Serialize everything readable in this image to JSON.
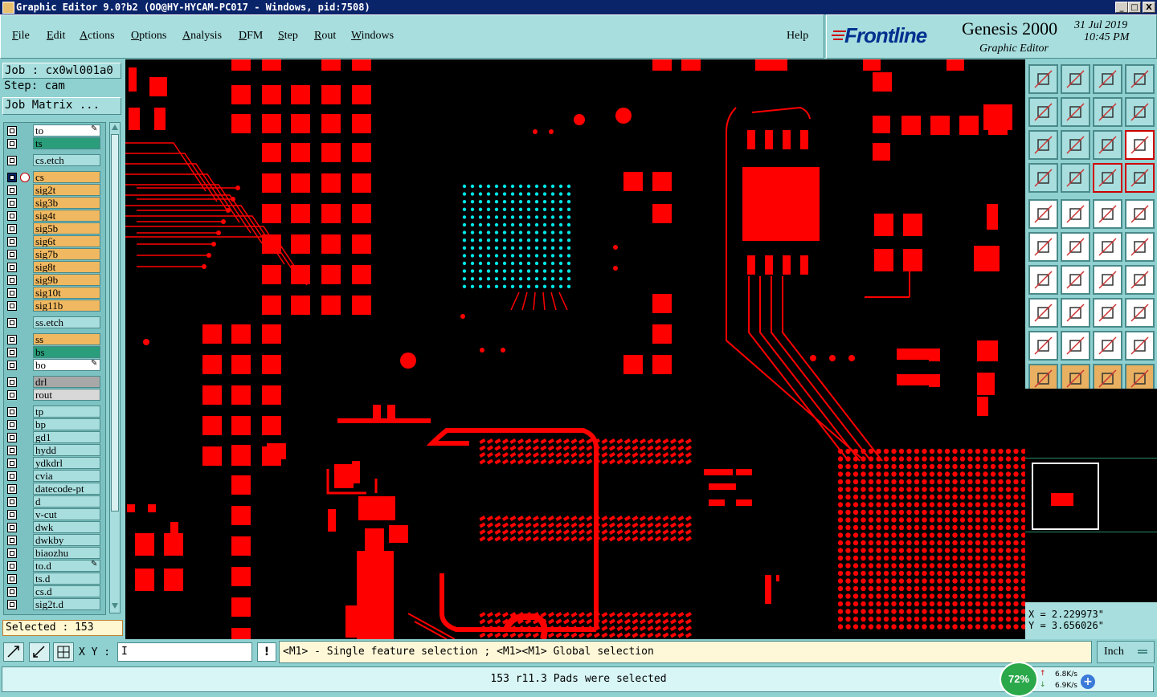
{
  "window": {
    "title": "Graphic Editor 9.0?b2  (OO@HY-HYCAM-PC017 - Windows, pid:7508)",
    "minimize_label": "_",
    "maximize_label": "□",
    "close_label": "X"
  },
  "menu": {
    "items": [
      {
        "underline": "F",
        "rest": "ile"
      },
      {
        "underline": "E",
        "rest": "dit"
      },
      {
        "underline": "A",
        "rest": "ctions"
      },
      {
        "underline": "O",
        "rest": "ptions"
      },
      {
        "underline": "A",
        "rest": "nalysis"
      },
      {
        "underline": "D",
        "rest": "FM"
      },
      {
        "underline": "S",
        "rest": "tep"
      },
      {
        "underline": "R",
        "rest": "out"
      },
      {
        "underline": "W",
        "rest": "indows"
      }
    ],
    "help": "Help"
  },
  "brand": {
    "logo": "Frontline",
    "product": "Genesis 2000",
    "subtitle": "Graphic Editor",
    "date": "31 Jul 2019",
    "time": "10:45 PM"
  },
  "job": {
    "job_label": "Job : cx0wl001a0",
    "step_label": "Step: cam",
    "matrix_button": "Job Matrix ..."
  },
  "layers": [
    {
      "name": "to",
      "color": "#ffffff",
      "active": false,
      "edit": true
    },
    {
      "name": "ts",
      "color": "#2a9d7a",
      "active": false
    },
    {
      "name": "cs.etch",
      "color": "#a8dede",
      "active": false
    },
    {
      "name": "cs",
      "color": "#f0b860",
      "active": true
    },
    {
      "name": "sig2t",
      "color": "#f0b860"
    },
    {
      "name": "sig3b",
      "color": "#f0b860"
    },
    {
      "name": "sig4t",
      "color": "#f0b860"
    },
    {
      "name": "sig5b",
      "color": "#f0b860"
    },
    {
      "name": "sig6t",
      "color": "#f0b860"
    },
    {
      "name": "sig7b",
      "color": "#f0b860"
    },
    {
      "name": "sig8t",
      "color": "#f0b860"
    },
    {
      "name": "sig9b",
      "color": "#f0b860"
    },
    {
      "name": "sig10t",
      "color": "#f0b860"
    },
    {
      "name": "sig11b",
      "color": "#f0b860"
    },
    {
      "name": "ss.etch",
      "color": "#a8dede"
    },
    {
      "name": "ss",
      "color": "#f0b860"
    },
    {
      "name": "bs",
      "color": "#2a9d7a"
    },
    {
      "name": "bo",
      "color": "#ffffff",
      "edit": true
    },
    {
      "name": "drl",
      "color": "#a8a8a8"
    },
    {
      "name": "rout",
      "color": "#d8d8d8"
    },
    {
      "name": "tp",
      "color": "#a8dede"
    },
    {
      "name": "bp",
      "color": "#a8dede"
    },
    {
      "name": "gd1",
      "color": "#a8dede"
    },
    {
      "name": "hydd",
      "color": "#a8dede"
    },
    {
      "name": "ydkdrl",
      "color": "#a8dede"
    },
    {
      "name": "cvia",
      "color": "#a8dede"
    },
    {
      "name": "datecode-pt",
      "color": "#a8dede"
    },
    {
      "name": "d",
      "color": "#a8dede"
    },
    {
      "name": "v-cut",
      "color": "#a8dede"
    },
    {
      "name": "dwk",
      "color": "#a8dede"
    },
    {
      "name": "dwkby",
      "color": "#a8dede"
    },
    {
      "name": "biaozhu",
      "color": "#a8dede"
    },
    {
      "name": "to.d",
      "color": "#a8dede",
      "edit": true
    },
    {
      "name": "ts.d",
      "color": "#a8dede"
    },
    {
      "name": "cs.d",
      "color": "#a8dede"
    },
    {
      "name": "sig2t.d",
      "color": "#a8dede"
    }
  ],
  "selected_label": "Selected : 153",
  "coords": {
    "x": "X = 2.229973\"",
    "y": "Y = 3.656026\""
  },
  "bottom": {
    "xy_label": "X Y :",
    "xy_value": "I",
    "warn_label": "!",
    "hint": "<M1> - Single feature selection ; <M1><M1> Global selection",
    "unit": "Inch"
  },
  "status": {
    "message": "153 r11.3 Pads were selected",
    "net_percent": "72%",
    "up_speed": "6.8K/s",
    "down_speed": "6.9K/s"
  },
  "colors": {
    "pcb_feature": "#ff0000",
    "selected_pad": "#00e5e5",
    "panel": "#8fd0d0"
  }
}
